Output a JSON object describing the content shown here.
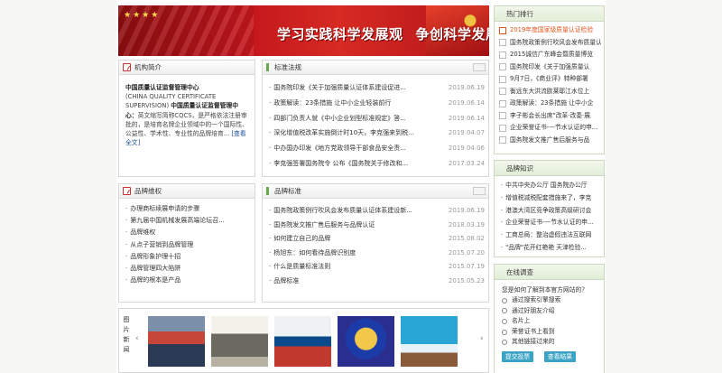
{
  "banner": {
    "slogan_part1": "学习实践科学发展观",
    "slogan_part2": "争创科学发展新优势",
    "stars": "★★★★"
  },
  "intro": {
    "title": "机构简介",
    "org_name": "中国质量认证监督管理中心",
    "org_name_en": "(CHINA QUALITY CERTIFICATE SUPERVISION)",
    "org_name_short_lead": "中国质量认证监督管理中心：",
    "description": "英文缩写简称CQCS，是严格依法注册审批的，是培育名牌企业领域中的一个国际性、公益性、学术性、专业性的品牌培育...",
    "more_link": "[查看全文]"
  },
  "rights": {
    "title": "品牌维权",
    "items": [
      "办理商标续展申请的步骤",
      "第九届中国机械发展高端论坛召...",
      "品牌维权",
      "从点子营销到品牌管理",
      "品牌形象护理十招",
      "品牌管理四大陷阱",
      "品牌的根本是产品"
    ]
  },
  "standards": {
    "title": "标准法规",
    "items": [
      {
        "title": "国务院印发《关于加强质量认证体系建设促进...",
        "date": "2019.06.19"
      },
      {
        "title": "政策解读：23条措施 让中小企业轻装前行",
        "date": "2019.06.14"
      },
      {
        "title": "四部门负责人就《中小企业划型标准规定》答...",
        "date": "2019.06.14"
      },
      {
        "title": "深化增值税改革实施倒计时10天，李克强来到税...",
        "date": "2019.04.07"
      },
      {
        "title": "中办国办印发《地方党政领导干部食品安全责...",
        "date": "2019.04.06"
      },
      {
        "title": "李克强签署国务院令 公布《国务院关于修改和...",
        "date": "2017.03.24"
      }
    ]
  },
  "brand_standards": {
    "title": "品牌标准",
    "items": [
      {
        "title": "国务院政策例行吹风会发布质量认证体系建设新...",
        "date": "2019.06.19"
      },
      {
        "title": "国务院发文推广售后服务与品牌认证",
        "date": "2018.03.19"
      },
      {
        "title": "如何建立自己的品牌",
        "date": "2015.08.02"
      },
      {
        "title": "杨旭东：如何看待品牌识别度",
        "date": "2015.07.20"
      },
      {
        "title": "什么是质量标准法则",
        "date": "2015.07.19"
      },
      {
        "title": "品牌标准",
        "date": "2015.05.23"
      }
    ]
  },
  "photos": {
    "label": "图片新闻",
    "prev": "‹",
    "next": "›"
  },
  "hot": {
    "title": "热门排行",
    "items": [
      "2019年度国家级质量认证检验",
      "国务院政策例行吹风会发布质量认",
      "2015诚信广东峰会暨质量博览",
      "国务院印发《关于加强质量认",
      "9月7日，《商业评》特种部署",
      "衡远东大洪流欧莱耶江水位上",
      "政策解读：23条措施 让中小企",
      "李子彬会长出席\"改革·改委·展",
      "企业荣誉证书-—节水认证的申...",
      "国务院发文推广售后服务与品"
    ]
  },
  "knowledge": {
    "title": "品牌知识",
    "items": [
      "中共中央办公厅 国务院办公厅",
      "增值税减税配套措施来了，李克",
      "港澳大湾区竞争政策高级研讨会",
      "企业荣誉证书-—节水认证的申...",
      "工商总局：整治虚假违法互联网",
      "\"品牌\"花开红艳艳 天津检验..."
    ]
  },
  "survey": {
    "title": "在线调查",
    "question": "您是如何了解到本官方网站的？",
    "options": [
      "通过搜索引擎搜索",
      "通过好朋友介绍",
      "名片上",
      "荣誉证书上看到",
      "其他链接过来的"
    ],
    "vote_button": "提交投票",
    "result_button": "查看结果"
  }
}
